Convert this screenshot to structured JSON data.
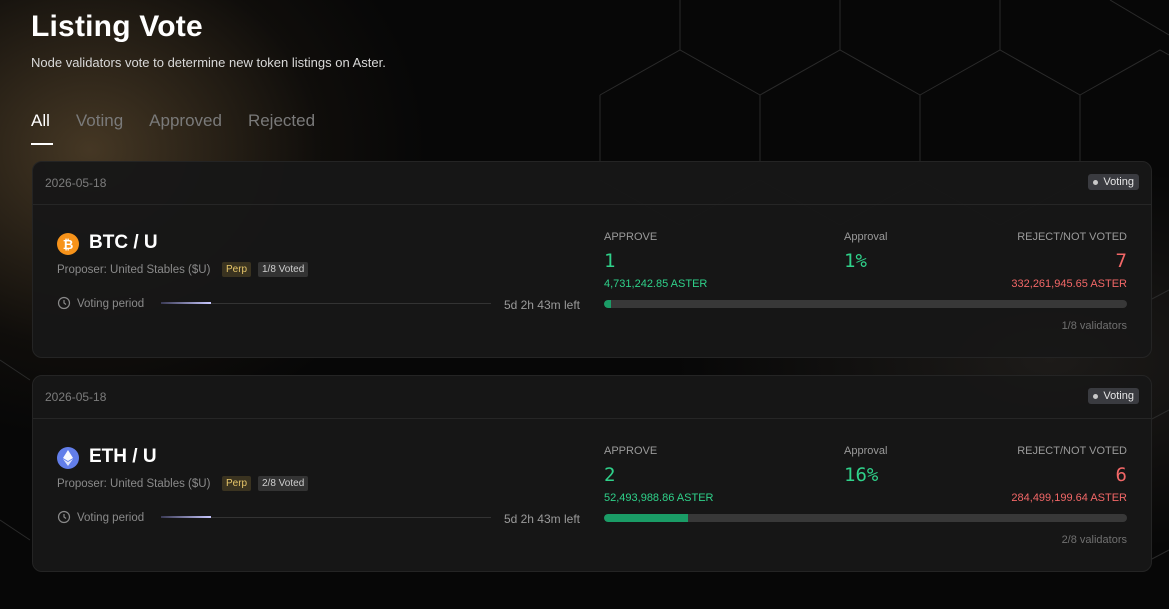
{
  "page": {
    "title": "Listing Vote",
    "subtitle": "Node validators vote to determine new token listings on Aster."
  },
  "tabs": [
    {
      "label": "All",
      "active": true
    },
    {
      "label": "Voting",
      "active": false
    },
    {
      "label": "Approved",
      "active": false
    },
    {
      "label": "Rejected",
      "active": false
    }
  ],
  "colors": {
    "approve": "#2fd18a",
    "reject": "#f26767",
    "btc": "#f7931a",
    "eth": "#627eea"
  },
  "listings": [
    {
      "date": "2026-05-18",
      "status": "Voting",
      "icon": "btc-icon",
      "pair": "BTC / U",
      "proposer": "Proposer: United Stables ($U)",
      "type_tag": "Perp",
      "voted_tag": "1/8 Voted",
      "period_label": "Voting period",
      "period_progress": 0.15,
      "time_left": "5d 2h 43m left",
      "approve_label": "APPROVE",
      "approve_count": "1",
      "approve_amount": "4,731,242.85 ASTER",
      "approval_label": "Approval",
      "approval_pct": "1%",
      "approval_fraction": 0.014,
      "reject_label": "REJECT/NOT VOTED",
      "reject_count": "7",
      "reject_amount": "332,261,945.65 ASTER",
      "validators": "1/8 validators"
    },
    {
      "date": "2026-05-18",
      "status": "Voting",
      "icon": "eth-icon",
      "pair": "ETH / U",
      "proposer": "Proposer: United Stables ($U)",
      "type_tag": "Perp",
      "voted_tag": "2/8 Voted",
      "period_label": "Voting period",
      "period_progress": 0.15,
      "time_left": "5d 2h 43m left",
      "approve_label": "APPROVE",
      "approve_count": "2",
      "approve_amount": "52,493,988.86 ASTER",
      "approval_label": "Approval",
      "approval_pct": "16%",
      "approval_fraction": 0.16,
      "reject_label": "REJECT/NOT VOTED",
      "reject_count": "6",
      "reject_amount": "284,499,199.64 ASTER",
      "validators": "2/8 validators"
    }
  ]
}
